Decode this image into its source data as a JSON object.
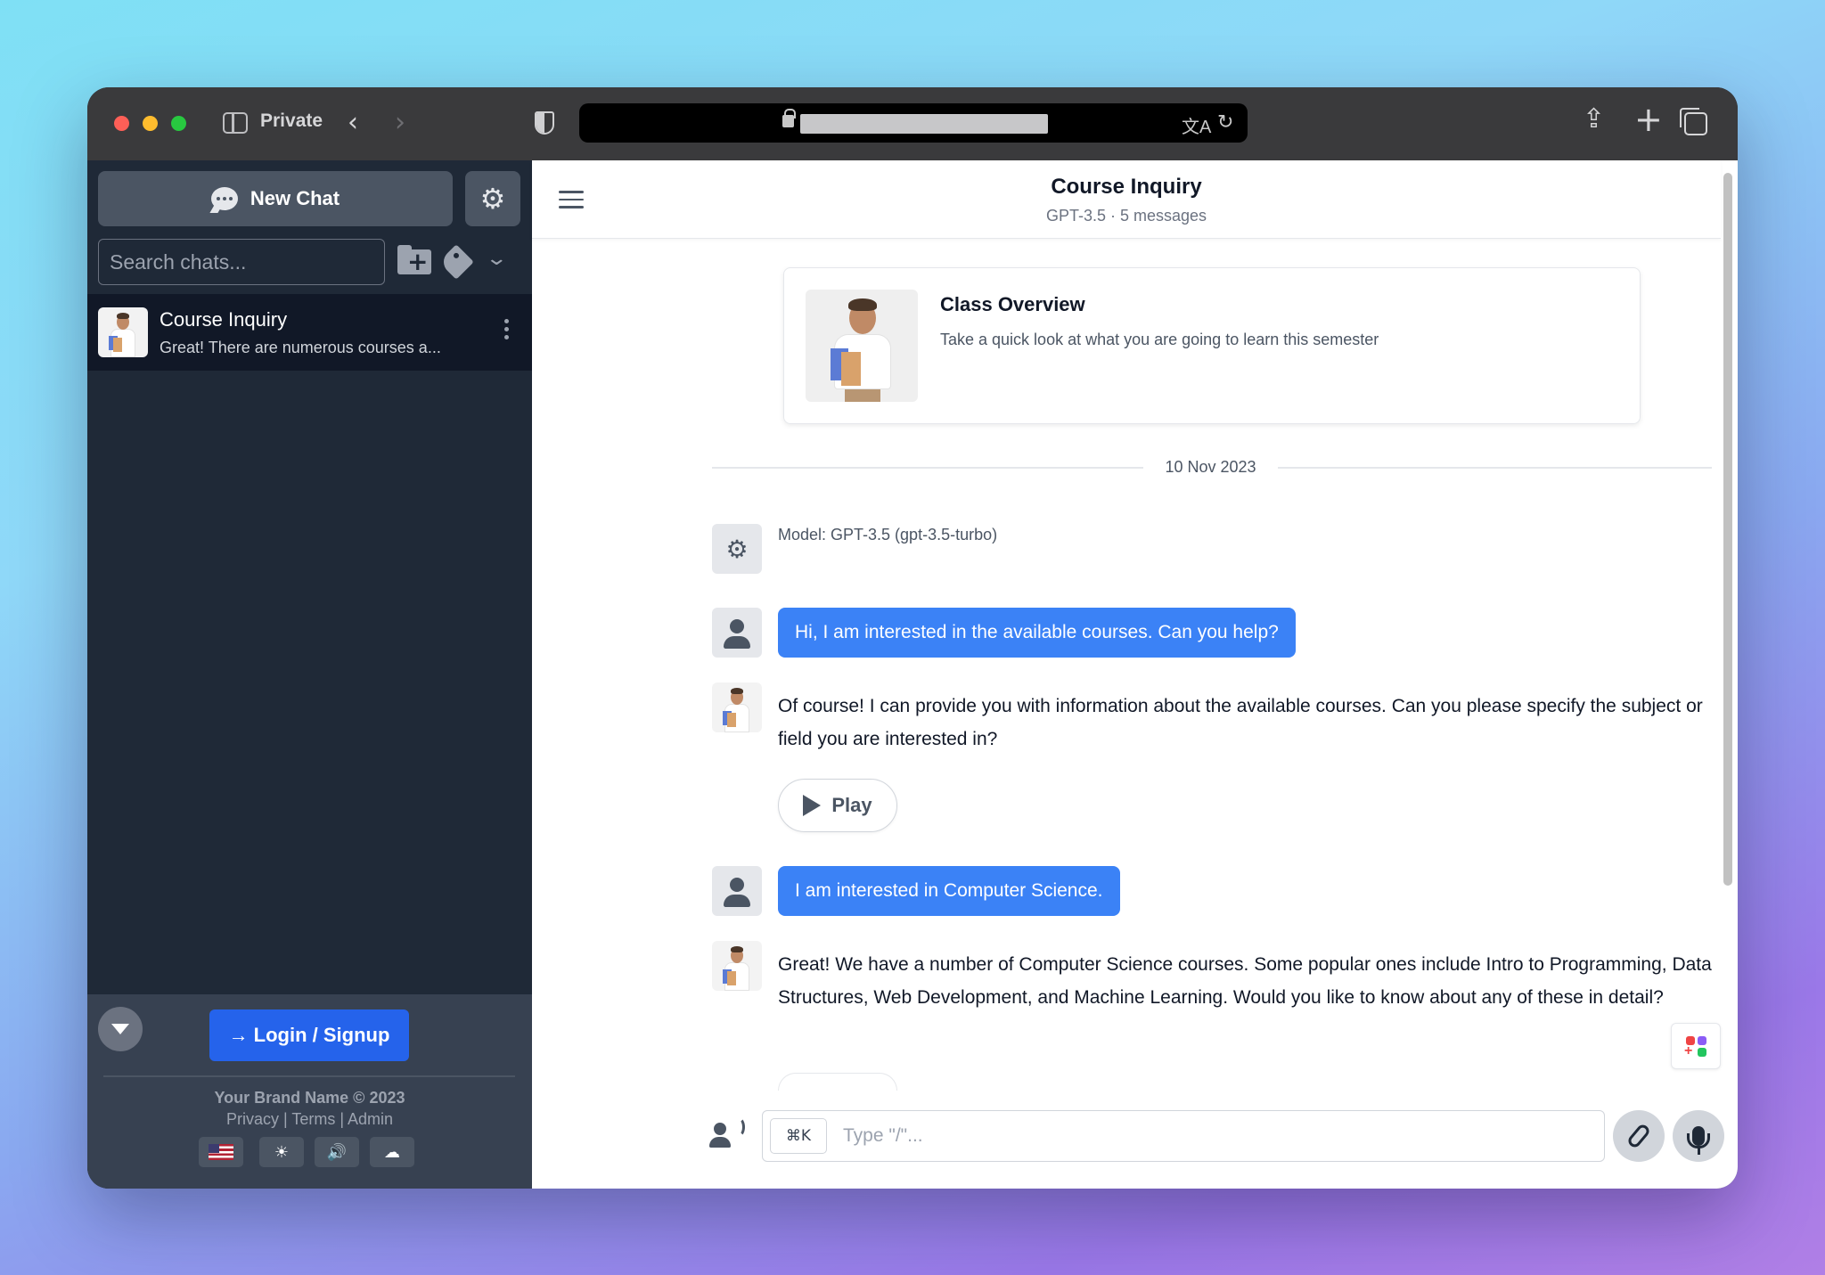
{
  "browser": {
    "private_label": "Private",
    "back": "‹",
    "forward": "›",
    "reload": "↻",
    "translate": "文A",
    "share": "⇪",
    "new_tab": "+"
  },
  "sidebar": {
    "new_chat_label": "New Chat",
    "settings_glyph": "⚙",
    "search_placeholder": "Search chats...",
    "chevron": "⌄",
    "chats": [
      {
        "title": "Course Inquiry",
        "preview": "Great! There are numerous courses a..."
      }
    ],
    "login_label": "→ Login / Signup",
    "brand": "Your Brand Name © 2023",
    "links": "Privacy | Terms | Admin",
    "icons": {
      "theme": "☀",
      "sound": "🔊",
      "cloud": "☁"
    }
  },
  "header": {
    "title": "Course Inquiry",
    "meta": "GPT-3.5 · 5 messages"
  },
  "overview": {
    "title": "Class Overview",
    "description": "Take a quick look at what you are going to learn this semester"
  },
  "date": "10 Nov 2023",
  "system": {
    "glyph": "⚙",
    "text": "Model: GPT-3.5 (gpt-3.5-turbo)"
  },
  "messages": [
    {
      "role": "user",
      "text": "Hi, I am interested in the available courses. Can you help?"
    },
    {
      "role": "assistant",
      "text": "Of course! I can provide you with information about the available courses. Can you please specify the subject or field you are interested in?"
    },
    {
      "role": "user",
      "text": "I am interested in Computer Science."
    },
    {
      "role": "assistant",
      "text": "Great! We have a number of Computer Science courses. Some popular ones include Intro to Programming, Data Structures, Web Development, and Machine Learning. Would you like to know about any of these in detail?"
    }
  ],
  "play_label": "Play",
  "composer": {
    "shortcut": "⌘K",
    "placeholder": "Type \"/\"..."
  },
  "colors": {
    "sidebar_bg": "#1f2937",
    "accent_blue": "#3b82f6",
    "login_blue": "#2563eb"
  }
}
